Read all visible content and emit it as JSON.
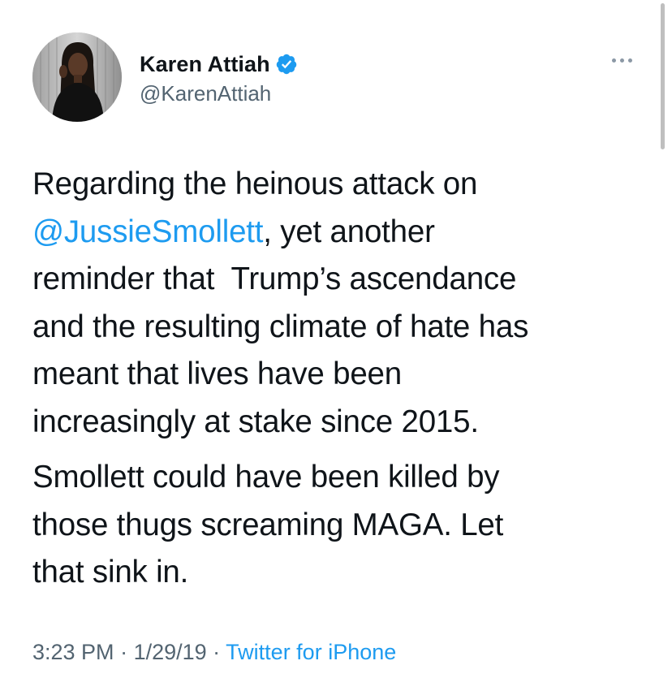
{
  "author": {
    "display_name": "Karen Attiah",
    "handle": "@KarenAttiah",
    "verified": true
  },
  "tweet": {
    "para1_before": "Regarding the heinous attack on",
    "mention": "@JussieSmollett",
    "para1_after": ", yet another\nreminder that  Trump’s ascendance\nand the resulting climate of hate has\nmeant that lives have been\nincreasingly at stake since 2015.",
    "para2": "Smollett could have been killed by\nthose thugs screaming MAGA. Let\nthat sink in."
  },
  "meta": {
    "time": "3:23 PM",
    "sep1": " · ",
    "date": "1/29/19",
    "sep2": " · ",
    "source": "Twitter for iPhone"
  },
  "icons": {
    "verified": "verified-badge-icon",
    "more": "more-options-icon"
  },
  "colors": {
    "accent": "#1d9bf0",
    "text": "#0f1419",
    "secondary": "#536471"
  }
}
